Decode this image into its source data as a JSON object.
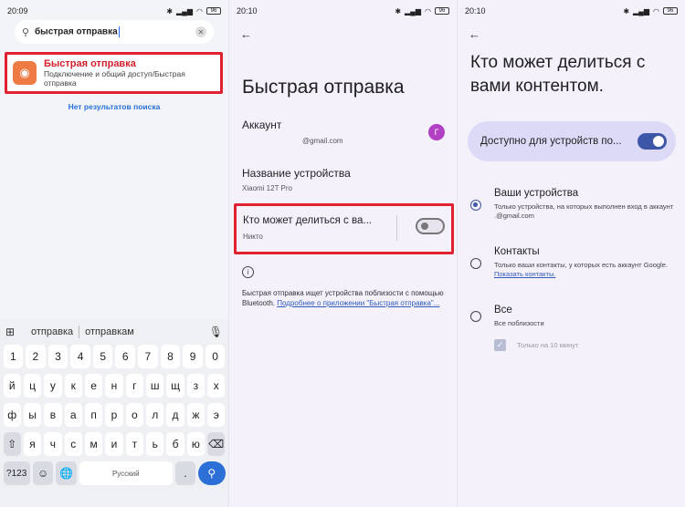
{
  "panel1": {
    "time": "20:09",
    "battery": "96",
    "search_query": "быстрая отправка",
    "result_title": "Быстрая отправка",
    "result_subtitle": "Подключение и общий доступ/Быстрая отправка",
    "no_results": "Нет результатов поиска",
    "suggestions": [
      "отправка",
      "отправкам"
    ],
    "keyboard_rows": [
      [
        "1",
        "2",
        "3",
        "4",
        "5",
        "6",
        "7",
        "8",
        "9",
        "0"
      ],
      [
        "й",
        "ц",
        "у",
        "к",
        "е",
        "н",
        "г",
        "ш",
        "щ",
        "з",
        "х"
      ],
      [
        "ф",
        "ы",
        "в",
        "а",
        "п",
        "р",
        "о",
        "л",
        "д",
        "ж",
        "э"
      ],
      [
        "⇧",
        "я",
        "ч",
        "с",
        "м",
        "и",
        "т",
        "ь",
        "б",
        "ю",
        "⌫"
      ]
    ],
    "sym_key": "?123",
    "space_label": "Русский",
    "period_key": "."
  },
  "panel2": {
    "time": "20:10",
    "battery": "96",
    "title": "Быстрая отправка",
    "account_label": "Аккаунт",
    "account_email": "@gmail.com",
    "avatar_letter": "Г",
    "device_name_label": "Название устройства",
    "device_name_value": "Xiaomi 12T Pro",
    "who_label": "Кто может делиться с ва...",
    "who_value": "Никто",
    "info_text": "Быстрая отправка ищет устройства поблизости с помощью Bluetooth.",
    "info_link": "Подробнее о приложении \"Быстрая отправка\"..."
  },
  "panel3": {
    "time": "20:10",
    "battery": "96",
    "title": "Кто может делиться с вами контентом.",
    "available_label": "Доступно для устройств по...",
    "options": [
      {
        "title": "Ваши устройства",
        "sub": "Только устройства, на которых выполнен вход в аккаунт                       .@gmail.com"
      },
      {
        "title": "Контакты",
        "sub": "Только ваши контакты, у которых есть аккаунт Google.",
        "link": "Показать контакты."
      },
      {
        "title": "Все",
        "sub": "Все поблизости"
      }
    ],
    "checkbox_label": "Только на 10 минут"
  }
}
